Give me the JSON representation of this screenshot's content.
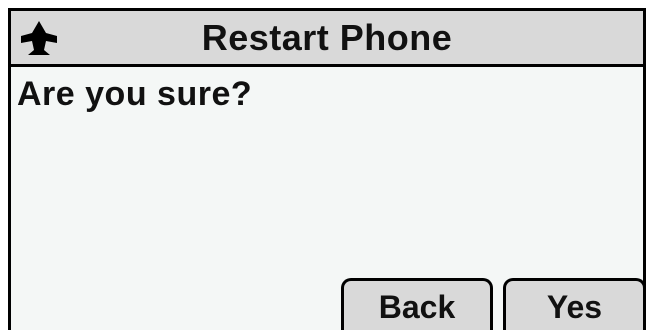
{
  "title_bar": {
    "title": "Restart Phone",
    "icon": "phone-device-icon"
  },
  "dialog": {
    "prompt": "Are you sure?"
  },
  "softkeys": {
    "back_label": "Back",
    "yes_label": "Yes"
  },
  "colors": {
    "screen_background": "#f4f7f6",
    "bar_background": "#d9d9d9",
    "text": "#111111",
    "border": "#000000"
  }
}
